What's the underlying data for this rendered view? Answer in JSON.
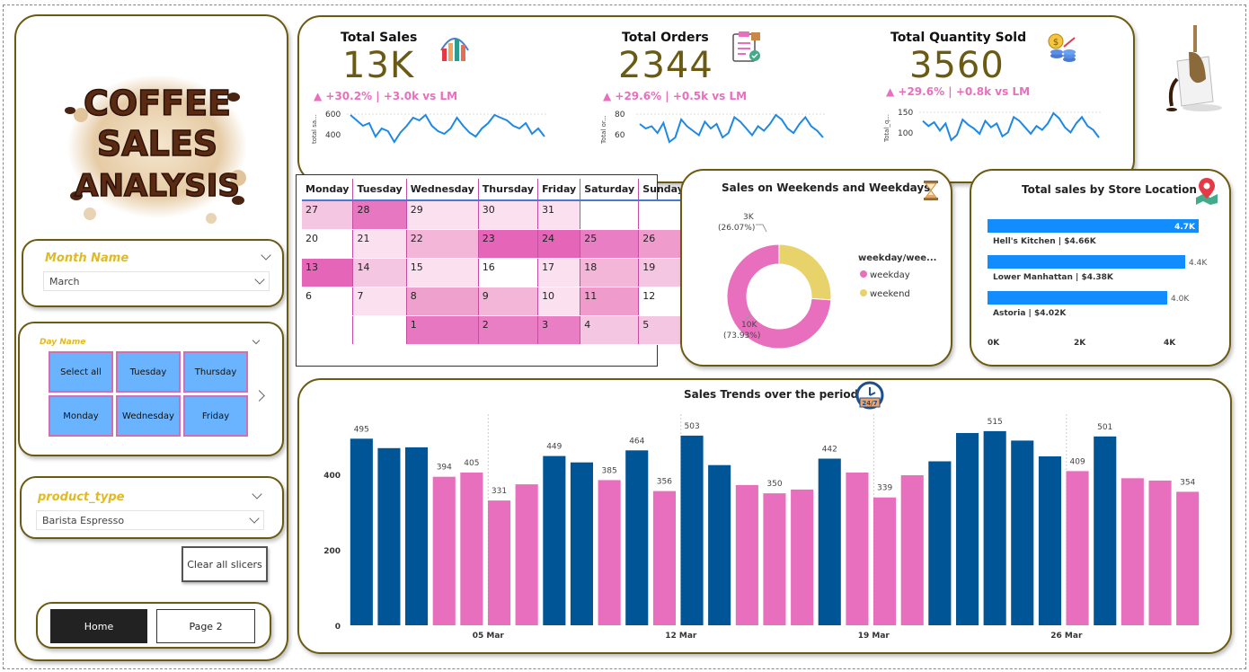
{
  "logo": {
    "line1": "COFFEE",
    "line2": "SALES",
    "line3": "ANALYSIS"
  },
  "slicers": {
    "month": {
      "title": "Month Name",
      "value": "March"
    },
    "day": {
      "title": "Day Name",
      "options": [
        "Select all",
        "Tuesday",
        "Thursday",
        "Monday",
        "Wednesday",
        "Friday"
      ]
    },
    "product": {
      "title": "product_type",
      "value": "Barista Espresso"
    },
    "clear_label": "Clear all slicers"
  },
  "nav": {
    "home": "Home",
    "page2": "Page 2"
  },
  "kpis": [
    {
      "label": "Total Sales",
      "value": "13K",
      "delta": "▲ +30.2% | +3.0k vs LM",
      "axis": "total sa...",
      "ticks": [
        "600",
        "400"
      ],
      "spark": [
        460,
        440,
        420,
        430,
        380,
        410,
        400,
        360,
        395,
        420,
        450,
        440,
        460,
        420,
        400,
        390,
        410,
        450,
        420,
        395,
        380,
        410,
        430,
        460,
        450,
        440,
        420,
        410,
        430,
        390,
        410,
        380
      ]
    },
    {
      "label": "Total Orders",
      "value": "2344",
      "delta": "▲ +29.6% | +0.5k vs LM",
      "axis": "Total or...",
      "ticks": [
        "80",
        "60"
      ],
      "spark": [
        74,
        70,
        72,
        66,
        75,
        58,
        62,
        78,
        72,
        68,
        64,
        76,
        70,
        74,
        62,
        66,
        80,
        76,
        70,
        64,
        72,
        68,
        74,
        82,
        78,
        70,
        66,
        74,
        80,
        72,
        68,
        62
      ]
    },
    {
      "label": "Total Quantity Sold",
      "value": "3560",
      "delta": "▲ +29.6% | +0.8k vs LM",
      "axis": "Total_q...",
      "ticks": [
        "150",
        "100"
      ],
      "spark": [
        130,
        122,
        128,
        115,
        126,
        100,
        108,
        132,
        124,
        118,
        110,
        130,
        120,
        126,
        106,
        112,
        136,
        130,
        120,
        110,
        122,
        116,
        126,
        142,
        134,
        120,
        112,
        126,
        136,
        122,
        116,
        104
      ]
    }
  ],
  "calendar": {
    "headers": [
      "Monday",
      "Tuesday",
      "Wednesday",
      "Thursday",
      "Friday",
      "Saturday",
      "Sunday"
    ],
    "rows": [
      [
        {
          "d": "27",
          "c": "#f5c6e1"
        },
        {
          "d": "28",
          "c": "#e877c1"
        },
        {
          "d": "29",
          "c": "#fbe1f0"
        },
        {
          "d": "30",
          "c": "#fbe1f0"
        },
        {
          "d": "31",
          "c": "#fbe1f0"
        },
        {
          "d": "",
          "c": "#fff"
        },
        {
          "d": "",
          "c": "#fff"
        }
      ],
      [
        {
          "d": "20",
          "c": "#fff"
        },
        {
          "d": "21",
          "c": "#fbe1f0"
        },
        {
          "d": "22",
          "c": "#f3b6d8"
        },
        {
          "d": "23",
          "c": "#e566b8"
        },
        {
          "d": "24",
          "c": "#e566b8"
        },
        {
          "d": "25",
          "c": "#ea7ec4"
        },
        {
          "d": "26",
          "c": "#ef9ccc"
        }
      ],
      [
        {
          "d": "13",
          "c": "#e566b8"
        },
        {
          "d": "14",
          "c": "#f5c6e1"
        },
        {
          "d": "15",
          "c": "#fbe1f0"
        },
        {
          "d": "16",
          "c": "#fff"
        },
        {
          "d": "17",
          "c": "#fbe1f0"
        },
        {
          "d": "18",
          "c": "#f3b6d8"
        },
        {
          "d": "19",
          "c": "#f5c6e1"
        }
      ],
      [
        {
          "d": "6",
          "c": "#fff"
        },
        {
          "d": "7",
          "c": "#fbe1f0"
        },
        {
          "d": "8",
          "c": "#efa1ce"
        },
        {
          "d": "9",
          "c": "#f3b6d8"
        },
        {
          "d": "10",
          "c": "#fbe1f0"
        },
        {
          "d": "11",
          "c": "#ef9ccc"
        },
        {
          "d": "12",
          "c": "#fff"
        }
      ],
      [
        {
          "d": "",
          "c": "#fff"
        },
        {
          "d": "",
          "c": "#fff"
        },
        {
          "d": "1",
          "c": "#e877c1"
        },
        {
          "d": "2",
          "c": "#ea7ec4"
        },
        {
          "d": "3",
          "c": "#ea7ec4"
        },
        {
          "d": "4",
          "c": "#f5c6e1"
        },
        {
          "d": "5",
          "c": "#f5c6e1"
        }
      ]
    ]
  },
  "weekend": {
    "title": "Sales on Weekends and Weekdays",
    "legend_title": "weekday/wee...",
    "slices": [
      {
        "name": "weekday",
        "value": 73.93,
        "label": "10K",
        "pct": "(73.93%)",
        "color": "#e86fbd"
      },
      {
        "name": "weekend",
        "value": 26.07,
        "label": "3K",
        "pct": "(26.07%)",
        "color": "#e8d36a"
      }
    ]
  },
  "store": {
    "title": "Total sales by Store Location",
    "bars": [
      {
        "name": "Hell's Kitchen | $4.66K",
        "value": 4.7,
        "label": "4.7K"
      },
      {
        "name": "Lower Manhattan | $4.38K",
        "value": 4.4,
        "label": "4.4K"
      },
      {
        "name": "Astoria | $4.02K",
        "value": 4.0,
        "label": "4.0K"
      }
    ],
    "ticks": [
      "0K",
      "2K",
      "4K"
    ]
  },
  "chart_data": {
    "type": "bar",
    "title": "Sales Trends over the period",
    "ylim": [
      0,
      560
    ],
    "yticks": [
      0,
      200,
      400
    ],
    "xticks": [
      {
        "i": 4,
        "label": "05 Mar"
      },
      {
        "i": 11,
        "label": "12 Mar"
      },
      {
        "i": 18,
        "label": "19 Mar"
      },
      {
        "i": 25,
        "label": "26 Mar"
      }
    ],
    "values": [
      495,
      470,
      472,
      394,
      405,
      331,
      374,
      449,
      432,
      385,
      464,
      356,
      503,
      425,
      372,
      350,
      360,
      442,
      405,
      339,
      398,
      435,
      510,
      515,
      490,
      448,
      409,
      501,
      390,
      384,
      354
    ],
    "labels": [
      "495",
      "",
      "",
      "394",
      "405",
      "331",
      "",
      "449",
      "",
      "385",
      "464",
      "356",
      "503",
      "",
      "",
      "350",
      "",
      "442",
      "",
      "339",
      "",
      "",
      "",
      "515",
      "",
      "",
      "409",
      "501",
      "",
      "",
      "354"
    ],
    "colors": [
      "#005596",
      "#005596",
      "#005596",
      "#e86fbd",
      "#e86fbd",
      "#e86fbd",
      "#e86fbd",
      "#005596",
      "#005596",
      "#e86fbd",
      "#005596",
      "#e86fbd",
      "#005596",
      "#005596",
      "#e86fbd",
      "#e86fbd",
      "#e86fbd",
      "#005596",
      "#e86fbd",
      "#e86fbd",
      "#e86fbd",
      "#005596",
      "#005596",
      "#005596",
      "#005596",
      "#005596",
      "#e86fbd",
      "#005596",
      "#e86fbd",
      "#e86fbd",
      "#e86fbd"
    ]
  }
}
